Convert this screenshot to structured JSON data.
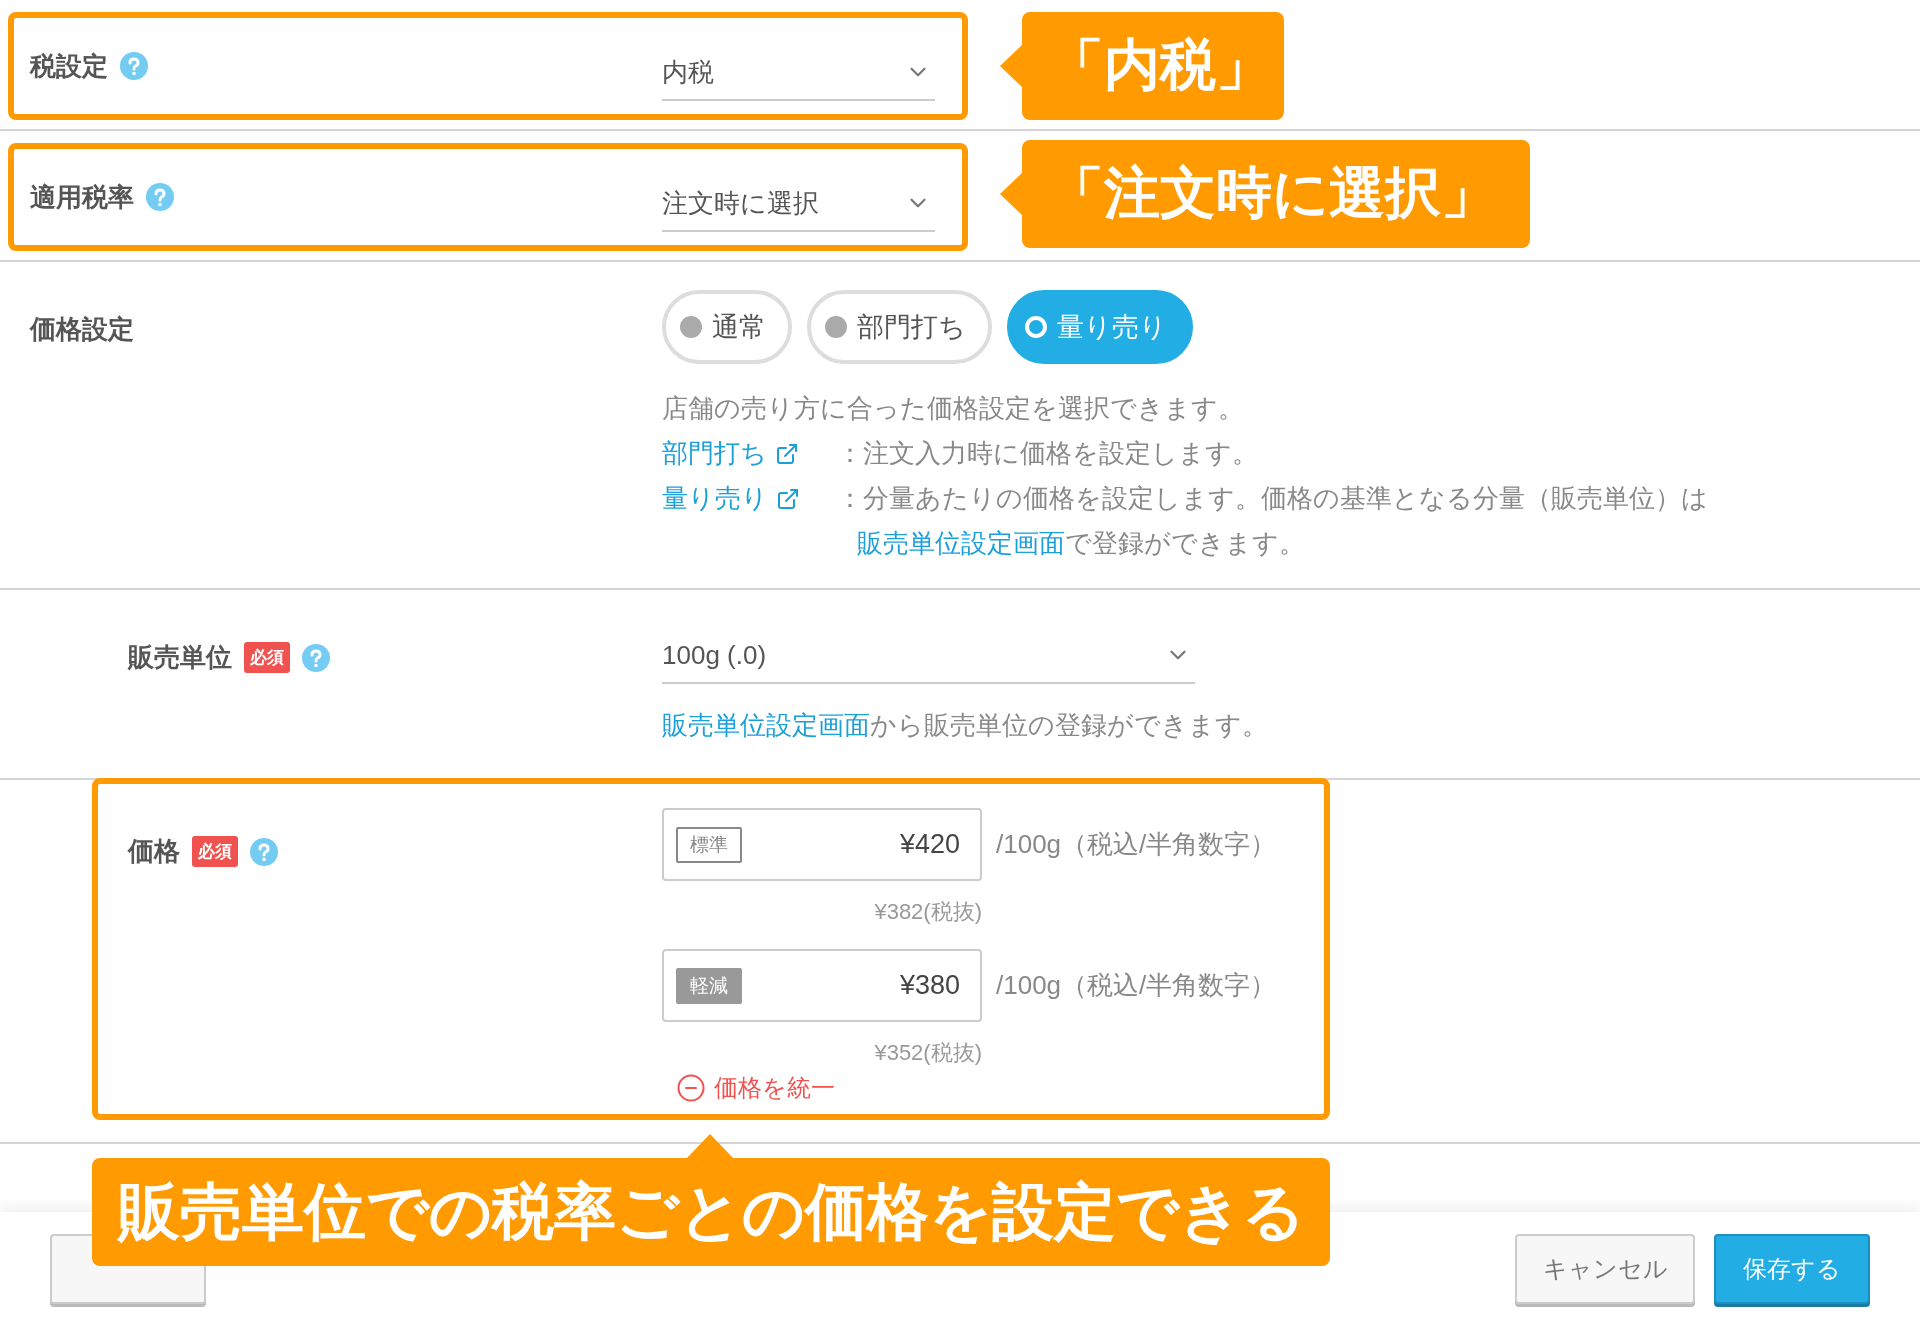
{
  "tax_setting": {
    "label": "税設定",
    "value": "内税",
    "highlighted": true
  },
  "tax_rate": {
    "label": "適用税率",
    "value": "注文時に選択",
    "highlighted": true
  },
  "price_setting": {
    "label": "価格設定",
    "options": [
      {
        "label": "通常",
        "selected": false
      },
      {
        "label": "部門打ち",
        "selected": false
      },
      {
        "label": "量り売り",
        "selected": true
      }
    ],
    "description": "店舗の売り方に合った価格設定を選択できます。",
    "notes": [
      {
        "link": "部門打ち",
        "segments": [
          {
            "text": "：注文入力時に価格を設定します。"
          }
        ]
      },
      {
        "link": "量り売り",
        "segments": [
          {
            "text": "：分量あたりの価格を設定します。価格の基準となる分量（販売単位）は"
          },
          {
            "link": "販売単位設定画面"
          },
          {
            "text": "で登録ができます。"
          }
        ]
      }
    ]
  },
  "sales_unit": {
    "label": "販売単位",
    "required": "必須",
    "value": "100g (.0)",
    "hint_link": "販売単位設定画面",
    "hint_text": "から販売単位の登録ができます。"
  },
  "price": {
    "label": "価格",
    "required": "必須",
    "highlighted": true,
    "entries": [
      {
        "tag": "標準",
        "kind": "outline",
        "value": "¥420",
        "unit": "/100g（税込/半角数字）",
        "excluded": "¥382(税抜)"
      },
      {
        "tag": "軽減",
        "kind": "filled",
        "value": "¥380",
        "unit": "/100g（税込/半角数字）",
        "excluded": "¥352(税抜)"
      }
    ],
    "unify": "価格を統一"
  },
  "callouts": [
    "「内税」",
    "「注文時に選択」",
    "販売単位での税率ごとの価格を設定できる"
  ],
  "footer": {
    "buttons": [
      {
        "kind": "default"
      },
      {
        "label": "キャンセル",
        "kind": "default"
      },
      {
        "label": "保存する",
        "kind": "primary"
      }
    ]
  }
}
